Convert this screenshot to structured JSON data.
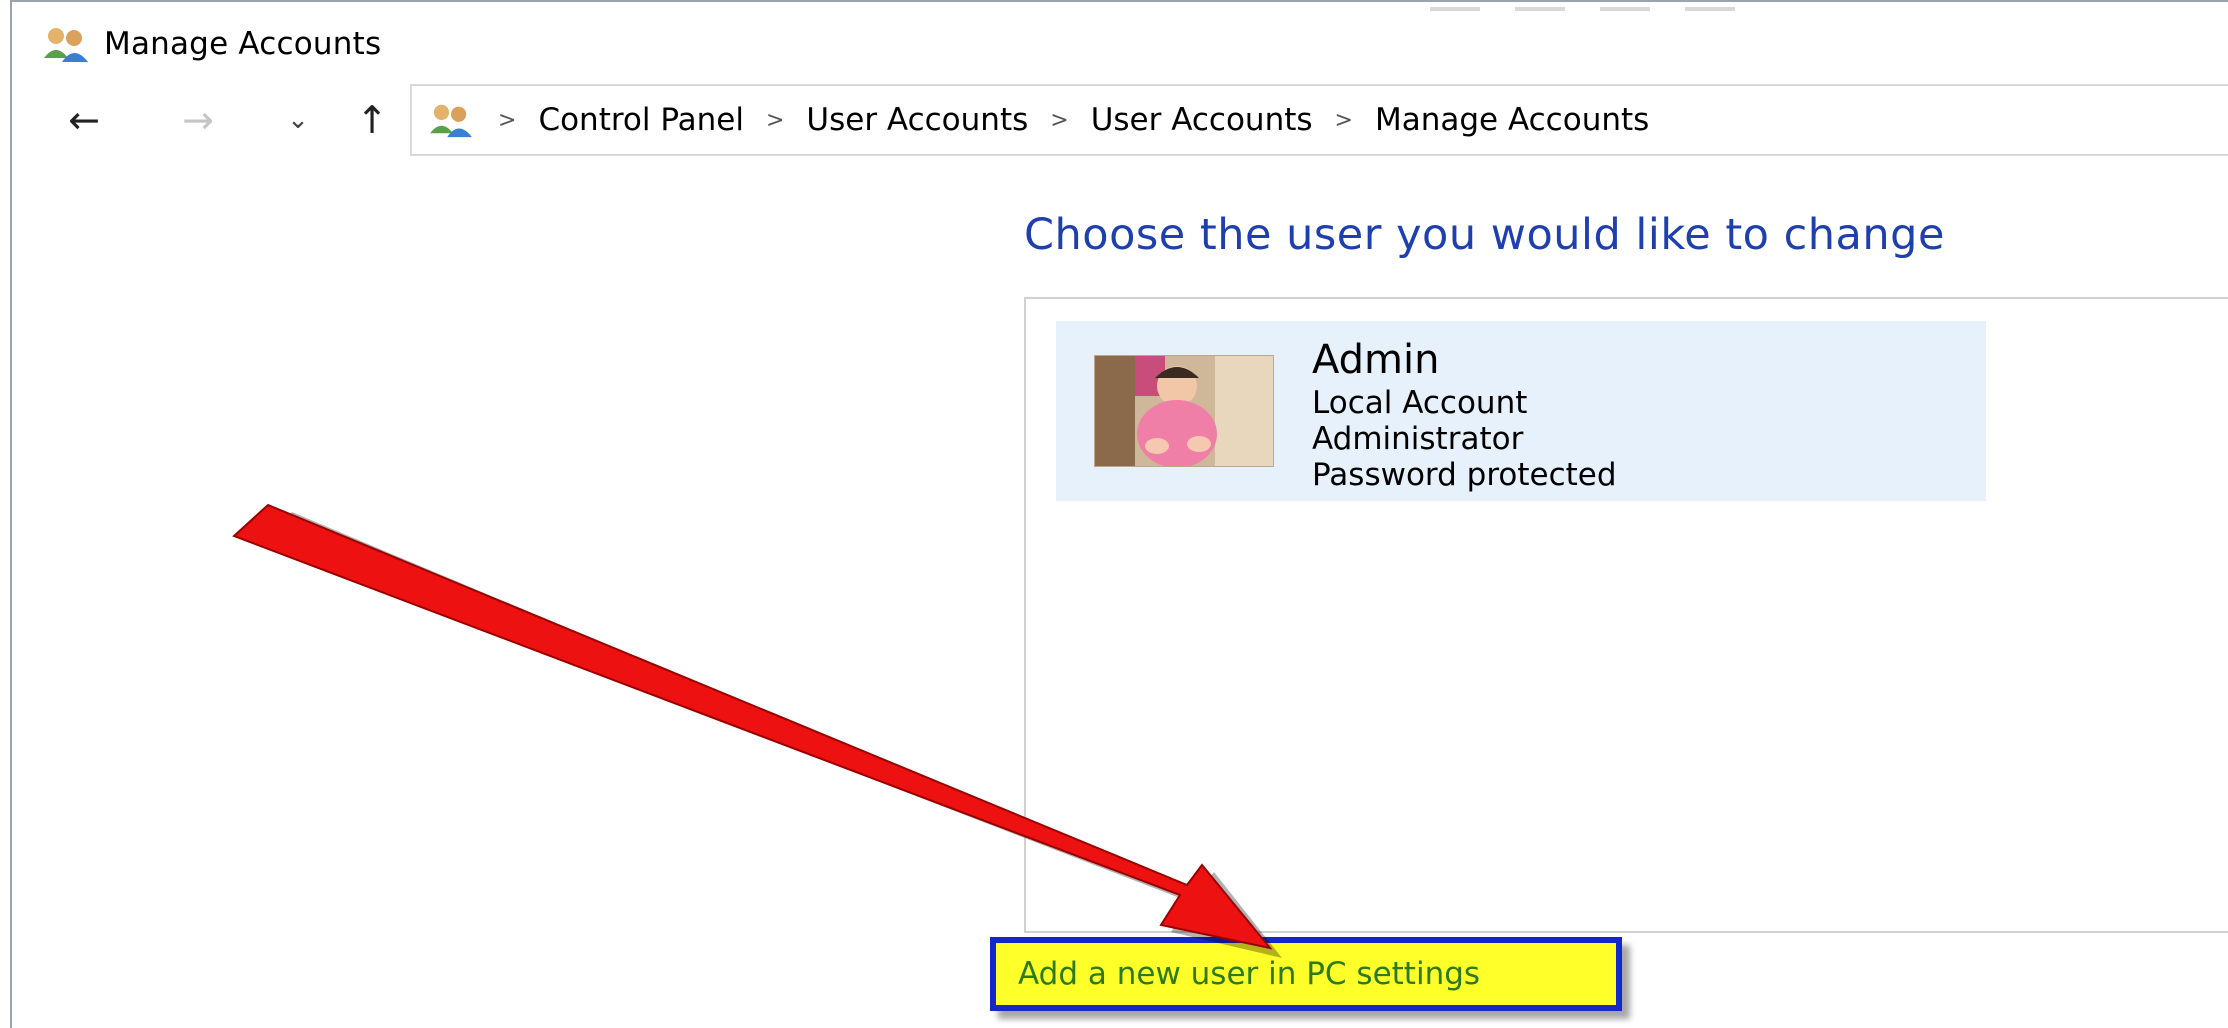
{
  "window": {
    "title": "Manage Accounts"
  },
  "nav": {
    "back_glyph": "←",
    "forward_glyph": "→",
    "recent_glyph": "⌄",
    "up_glyph": "↑"
  },
  "address": {
    "icon": "user-accounts-icon",
    "separator": ">",
    "crumbs": [
      "Control Panel",
      "User Accounts",
      "User Accounts",
      "Manage Accounts"
    ]
  },
  "main": {
    "heading": "Choose the user you would like to change",
    "accounts": [
      {
        "name": "Admin",
        "type": "Local Account",
        "role": "Administrator",
        "status": "Password protected"
      }
    ],
    "add_user_link": "Add a new user in PC settings"
  },
  "colors": {
    "heading": "#1e3fae",
    "tile_bg": "#e6f1fb",
    "highlight_bg": "#ffff2a",
    "highlight_border": "#1428c8",
    "link_text": "#2c7a1a",
    "arrow": "#ee1111"
  }
}
